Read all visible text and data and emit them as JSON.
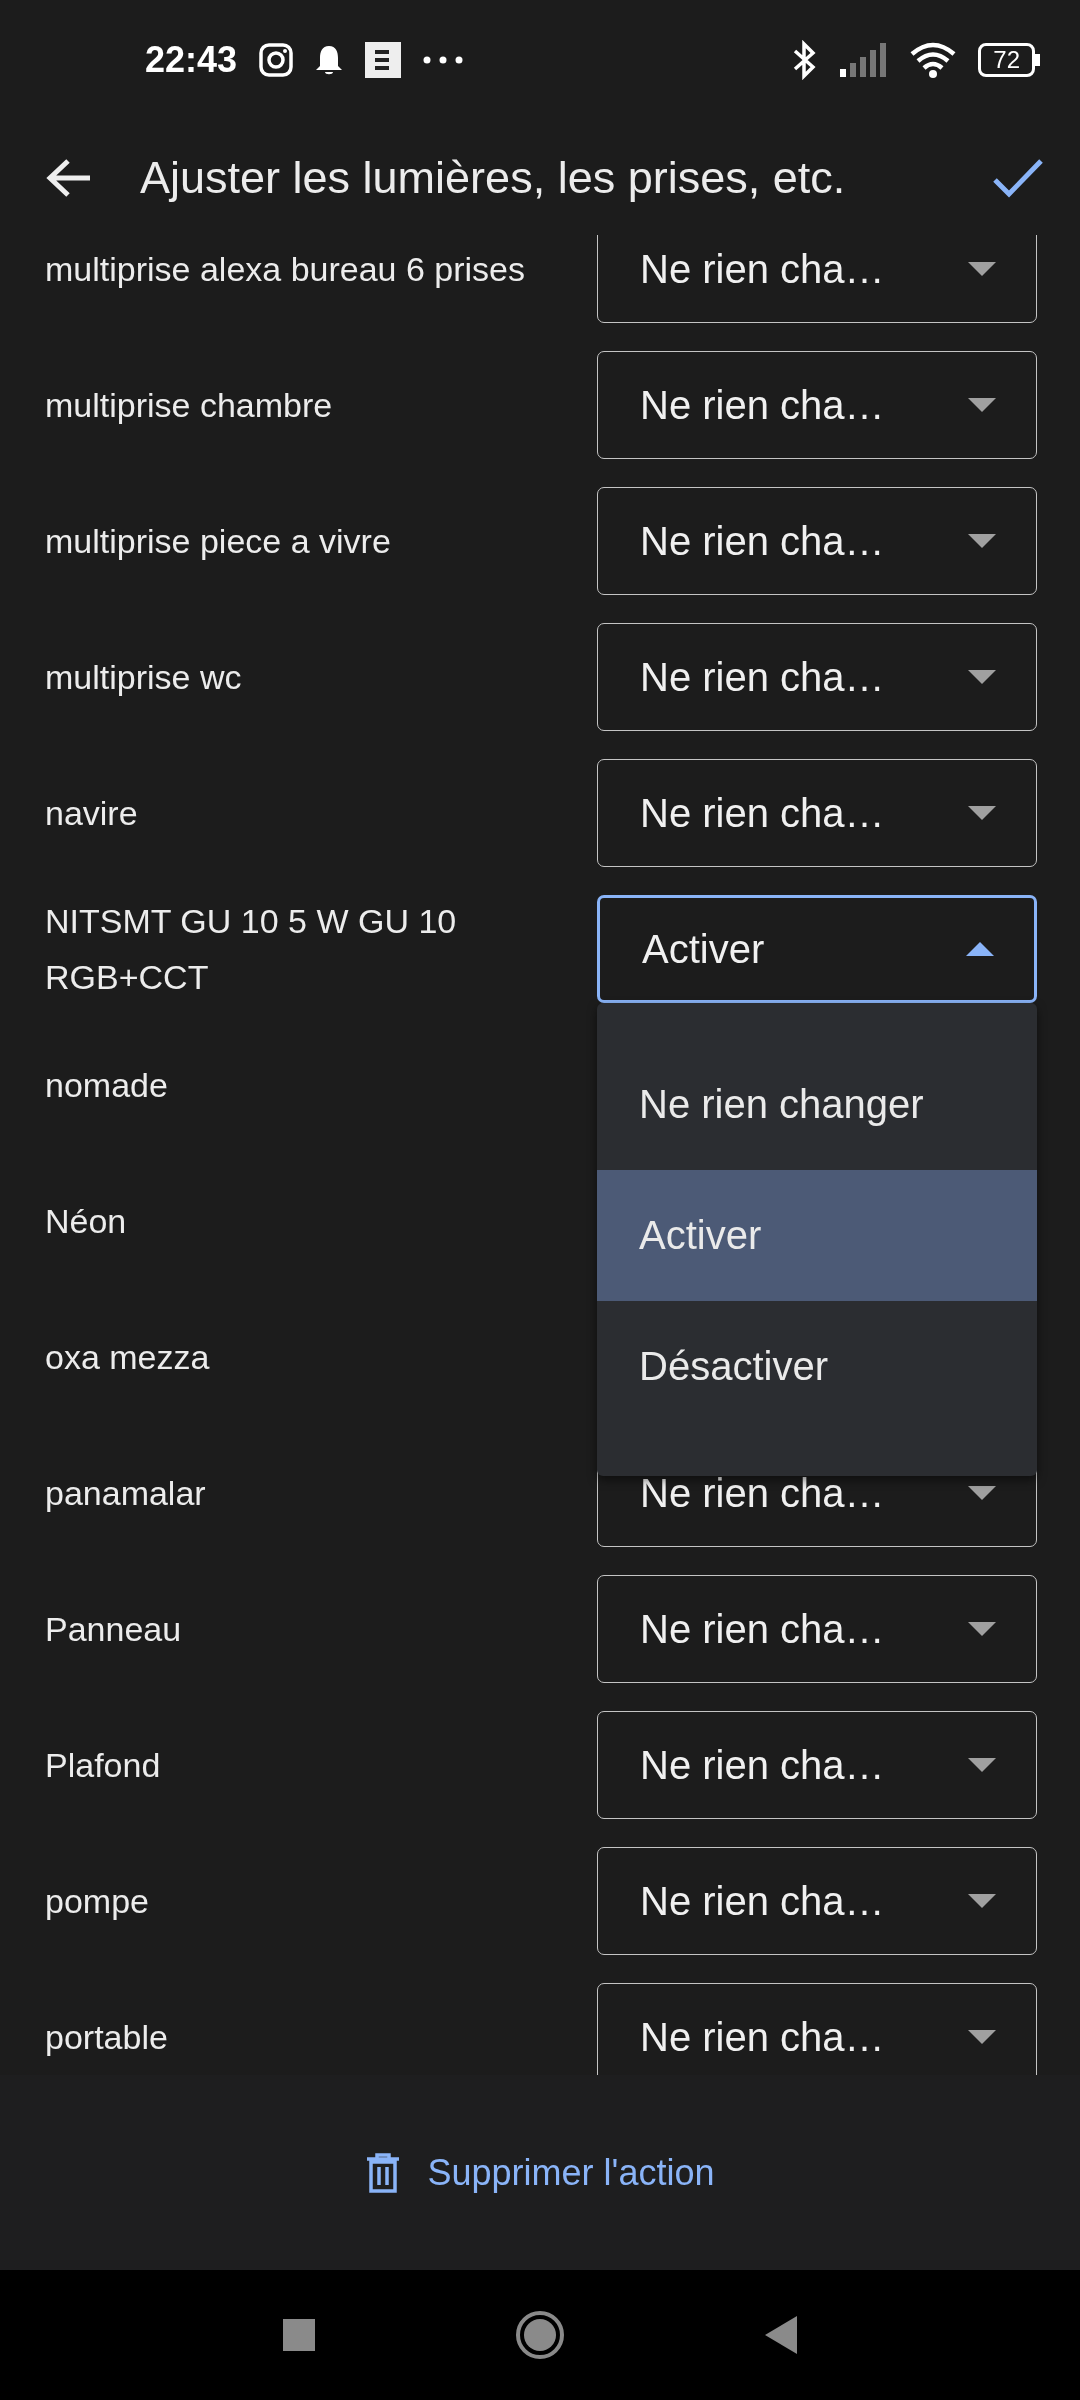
{
  "status_bar": {
    "time": "22:43",
    "battery": "72"
  },
  "header": {
    "title": "Ajuster les lumières, les prises, etc."
  },
  "devices": [
    {
      "name": "multiprise alexa bureau 6 prises",
      "value": "Ne rien cha…",
      "expanded": false
    },
    {
      "name": "multiprise chambre",
      "value": "Ne rien cha…",
      "expanded": false
    },
    {
      "name": "multiprise piece a vivre",
      "value": "Ne rien cha…",
      "expanded": false
    },
    {
      "name": "multiprise wc",
      "value": "Ne rien cha…",
      "expanded": false
    },
    {
      "name": "navire",
      "value": "Ne rien cha…",
      "expanded": false
    },
    {
      "name": "NITSMT GU 10 5 W GU 10 RGB+CCT",
      "value": "Activer",
      "expanded": true,
      "options": [
        {
          "label": "Ne rien changer",
          "selected": false
        },
        {
          "label": "Activer",
          "selected": true
        },
        {
          "label": "Désactiver",
          "selected": false
        }
      ]
    },
    {
      "name": "nomade"
    },
    {
      "name": "Néon"
    },
    {
      "name": "oxa mezza"
    },
    {
      "name": "panamalar",
      "value": "Ne rien cha…",
      "expanded": false
    },
    {
      "name": "Panneau",
      "value": "Ne rien cha…",
      "expanded": false
    },
    {
      "name": "Plafond",
      "value": "Ne rien cha…",
      "expanded": false
    },
    {
      "name": "pompe",
      "value": "Ne rien cha…",
      "expanded": false
    },
    {
      "name": "portable",
      "value": "Ne rien cha…",
      "expanded": false
    }
  ],
  "footer": {
    "delete_label": "Supprimer l'action"
  }
}
